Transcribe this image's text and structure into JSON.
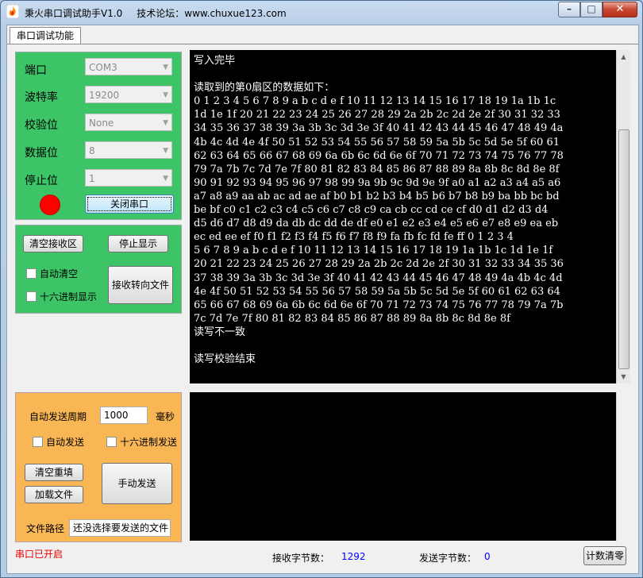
{
  "window": {
    "title": "秉火串口调试助手V1.0",
    "forum": "技术论坛：www.chuxue123.com",
    "controls": {
      "minimize": "–",
      "maximize": "□",
      "close": "✕"
    }
  },
  "tabs": [
    {
      "label": "串口调试功能"
    }
  ],
  "port_settings": {
    "port_label": "端口",
    "port_value": "COM3",
    "baud_label": "波特率",
    "baud_value": "19200",
    "parity_label": "校验位",
    "parity_value": "None",
    "databits_label": "数据位",
    "databits_value": "8",
    "stopbits_label": "停止位",
    "stopbits_value": "1",
    "status_color": "#ff0000",
    "close_port_button": "关闭串口"
  },
  "receive_controls": {
    "clear_button": "清空接收区",
    "stop_display_button": "停止显示",
    "auto_clear": "自动清空",
    "hex_display": "十六进制显示",
    "redirect_button": "接收转向文件"
  },
  "receive_area": {
    "lines": [
      "写入完毕",
      "",
      "读取到的第0扇区的数据如下：",
      "0 1 2 3 4 5 6 7 8 9 a b c d e f 10 11 12 13 14 15 16 17 18 19 1a 1b 1c",
      "1d 1e 1f 20 21 22 23 24 25 26 27 28 29 2a 2b 2c 2d 2e 2f 30 31 32 33",
      "34 35 36 37 38 39 3a 3b 3c 3d 3e 3f 40 41 42 43 44 45 46 47 48 49 4a",
      "4b 4c 4d 4e 4f 50 51 52 53 54 55 56 57 58 59 5a 5b 5c 5d 5e 5f 60 61",
      "62 63 64 65 66 67 68 69 6a 6b 6c 6d 6e 6f 70 71 72 73 74 75 76 77 78",
      "79 7a 7b 7c 7d 7e 7f 80 81 82 83 84 85 86 87 88 89 8a 8b 8c 8d 8e 8f",
      "90 91 92 93 94 95 96 97 98 99 9a 9b 9c 9d 9e 9f a0 a1 a2 a3 a4 a5 a6",
      "a7 a8 a9 aa ab ac ad ae af b0 b1 b2 b3 b4 b5 b6 b7 b8 b9 ba bb bc bd",
      "be bf c0 c1 c2 c3 c4 c5 c6 c7 c8 c9 ca cb cc cd ce cf d0 d1 d2 d3 d4",
      "d5 d6 d7 d8 d9 da db dc dd de df e0 e1 e2 e3 e4 e5 e6 e7 e8 e9 ea eb",
      "ec ed ee ef f0 f1 f2 f3 f4 f5 f6 f7 f8 f9 fa fb fc fd fe ff 0 1 2 3 4",
      "5 6 7 8 9 a b c d e f 10 11 12 13 14 15 16 17 18 19 1a 1b 1c 1d 1e 1f",
      "20 21 22 23 24 25 26 27 28 29 2a 2b 2c 2d 2e 2f 30 31 32 33 34 35 36",
      "37 38 39 3a 3b 3c 3d 3e 3f 40 41 42 43 44 45 46 47 48 49 4a 4b 4c 4d",
      "4e 4f 50 51 52 53 54 55 56 57 58 59 5a 5b 5c 5d 5e 5f 60 61 62 63 64",
      "65 66 67 68 69 6a 6b 6c 6d 6e 6f 70 71 72 73 74 75 76 77 78 79 7a 7b",
      "7c 7d 7e 7f 80 81 82 83 84 85 86 87 88 89 8a 8b 8c 8d 8e 8f",
      "读写不一致",
      "",
      "读写校验结束"
    ]
  },
  "send_controls": {
    "period_label": "自动发送周期",
    "period_value": "1000",
    "period_unit": "毫秒",
    "auto_send": "自动发送",
    "hex_send": "十六进制发送",
    "clear_refill_button": "清空重填",
    "load_file_button": "加载文件",
    "manual_send_button": "手动发送",
    "file_path_label": "文件路径",
    "file_path_value": "还没选择要发送的文件"
  },
  "status_bar": {
    "port_status": "串口已开启",
    "rx_label": "接收字节数：",
    "rx_value": "1292",
    "tx_label": "发送字节数：",
    "tx_value": "0",
    "clear_count_button": "计数清零"
  }
}
